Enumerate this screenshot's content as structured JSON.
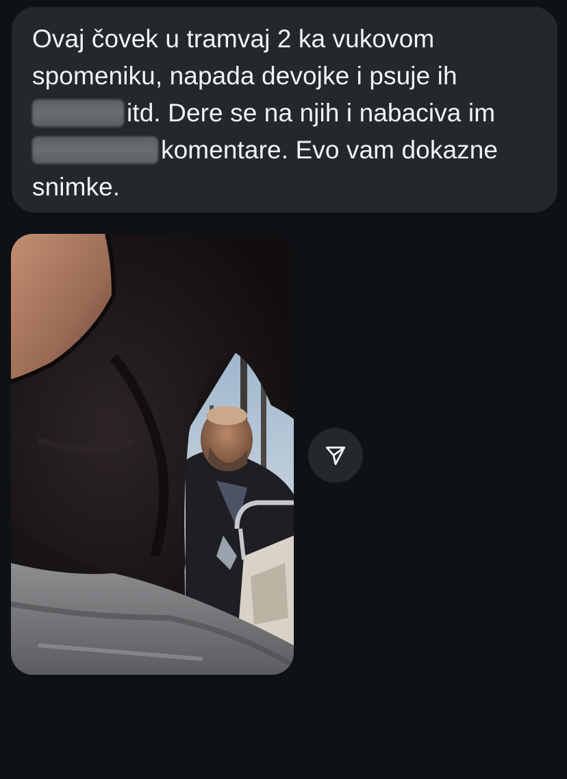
{
  "message": {
    "line1": "Ovaj čovek u tramvaj 2 ka vukovom",
    "line2": "spomeniku, napada devojke i psuje ih",
    "line3_after_redaction": "itd. Dere se na njih i nabaciva im",
    "line4_after_redaction": "komentare. Evo vam dokazne",
    "line5": "snimke."
  },
  "media": {
    "type": "photo"
  },
  "share": {
    "icon": "send-paper-plane-icon"
  },
  "colors": {
    "background": "#0e1116",
    "bubble": "#24272c",
    "text": "#f4f5f7",
    "redaction": "#64676c"
  }
}
